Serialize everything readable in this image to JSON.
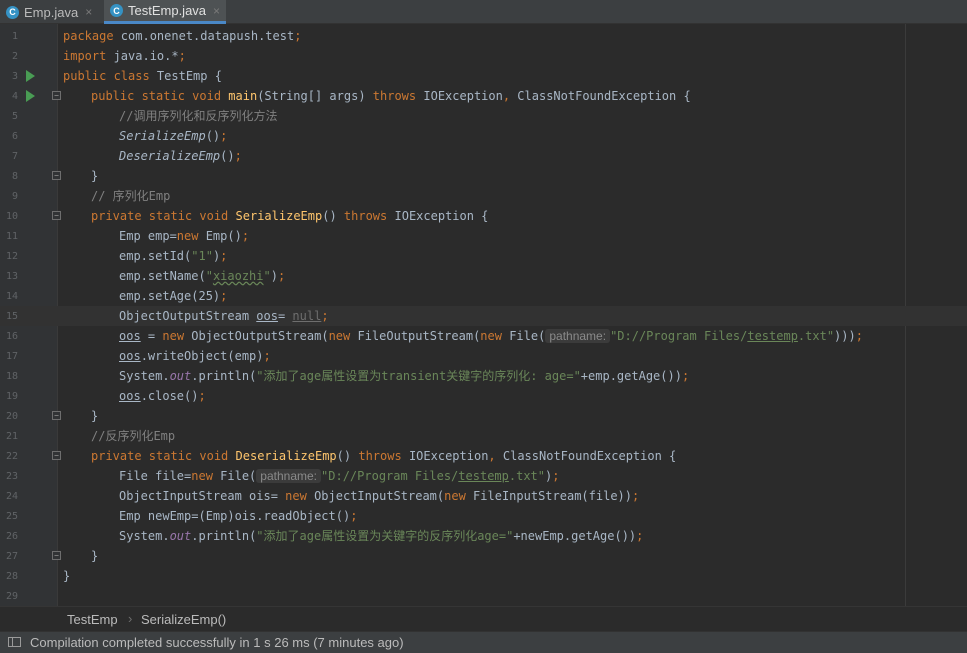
{
  "tabs": [
    {
      "icon": "C",
      "label": "Emp.java",
      "close": "×"
    },
    {
      "icon": "C",
      "label": "TestEmp.java",
      "close": "×"
    }
  ],
  "line_numbers": [
    "1",
    "2",
    "3",
    "4",
    "5",
    "6",
    "7",
    "8",
    "9",
    "10",
    "11",
    "12",
    "13",
    "14",
    "15",
    "16",
    "17",
    "18",
    "19",
    "20",
    "21",
    "22",
    "23",
    "24",
    "25",
    "26",
    "27",
    "28",
    "29"
  ],
  "code": {
    "l1": {
      "kw": "package",
      "rest": " com.onenet.datapush.test",
      "semi": ";"
    },
    "l2": {
      "kw": "import",
      "rest": " java.io.*",
      "semi": ";"
    },
    "l3": {
      "kw": "public class",
      "rest": " TestEmp {"
    },
    "l4": {
      "kw1": "public static void",
      "name": "main",
      "p1": "(String[] args) ",
      "kw2": "throws",
      "p2": " IOException",
      "comma": ",",
      "p3": " ClassNotFoundException {"
    },
    "l5": {
      "comment": "//调用序列化和反序列化方法"
    },
    "l6": {
      "call": "SerializeEmp",
      "paren": "()",
      "semi": ";"
    },
    "l7": {
      "call": "DeserializeEmp",
      "paren": "()",
      "semi": ";"
    },
    "l8": {
      "text": "}"
    },
    "l9": {
      "comment": "// 序列化Emp"
    },
    "l10": {
      "kw1": "private static void",
      "name": "SerializeEmp",
      "p1": "() ",
      "kw2": "throws",
      "p2": " IOException {"
    },
    "l11": {
      "a": "Emp emp=",
      "kw": "new",
      "b": " Emp()",
      "semi": ";"
    },
    "l12": {
      "a": "emp.setId(",
      "str": "\"1\"",
      "b": ")",
      "semi": ";"
    },
    "l13": {
      "a": "emp.setName(",
      "q1": "\"",
      "str": "xiaozhi",
      "q2": "\"",
      "b": ")",
      "semi": ";"
    },
    "l14": {
      "a": "emp.setAge(25)",
      "semi": ";"
    },
    "l15": {
      "a": "ObjectOutputStream ",
      "var": "oos",
      "b": "= ",
      "nul": "null",
      "semi": ";"
    },
    "l16": {
      "var": "oos",
      "a": " = ",
      "kw1": "new",
      "b": " ObjectOutputStream(",
      "kw2": "new",
      "c": " FileOutputStream(",
      "kw3": "new",
      "d": " File(",
      "hint": "pathname:",
      "s1": "\"D://Program Files/",
      "s2": "testemp",
      "s3": ".txt\"",
      "e": ")))",
      "semi": ";"
    },
    "l17": {
      "var": "oos",
      "a": ".writeObject(emp)",
      "semi": ";"
    },
    "l18": {
      "a": "System.",
      "out": "out",
      "b": ".println(",
      "str": "\"添加了age属性设置为transient关键字的序列化: age=\"",
      "c": "+emp.getAge())",
      "semi": ";"
    },
    "l19": {
      "var": "oos",
      "a": ".close()",
      "semi": ";"
    },
    "l20": {
      "text": "}"
    },
    "l21": {
      "comment": "//反序列化Emp"
    },
    "l22": {
      "kw1": "private static void",
      "name": "DeserializeEmp",
      "p1": "() ",
      "kw2": "throws",
      "p2": " IOException",
      "comma": ",",
      "p3": " ClassNotFoundException {"
    },
    "l23": {
      "a": "File file=",
      "kw": "new",
      "b": " File(",
      "hint": "pathname:",
      "s1": "\"D://Program Files/",
      "s2": "testemp",
      "s3": ".txt\"",
      "c": ")",
      "semi": ";"
    },
    "l24": {
      "a": "ObjectInputStream ois= ",
      "kw1": "new",
      "b": " ObjectInputStream(",
      "kw2": "new",
      "c": " FileInputStream(file))",
      "semi": ";"
    },
    "l25": {
      "a": "Emp newEmp=(Emp)ois.readObject()",
      "semi": ";"
    },
    "l26": {
      "a": "System.",
      "out": "out",
      "b": ".println(",
      "str": "\"添加了age属性设置为关键字的反序列化age=\"",
      "c": "+newEmp.getAge())",
      "semi": ";"
    },
    "l27": {
      "text": "}"
    },
    "l28": {
      "text": "}"
    }
  },
  "breadcrumb": [
    "TestEmp",
    "SerializeEmp()"
  ],
  "breadcrumb_sep": "›",
  "status": {
    "text": "Compilation completed successfully in 1 s 26 ms (7 minutes ago)"
  },
  "colors": {
    "keyword": "#cc7832",
    "string": "#6a8759",
    "method": "#ffc66d",
    "comment": "#808080",
    "accent": "#4a88c7"
  }
}
